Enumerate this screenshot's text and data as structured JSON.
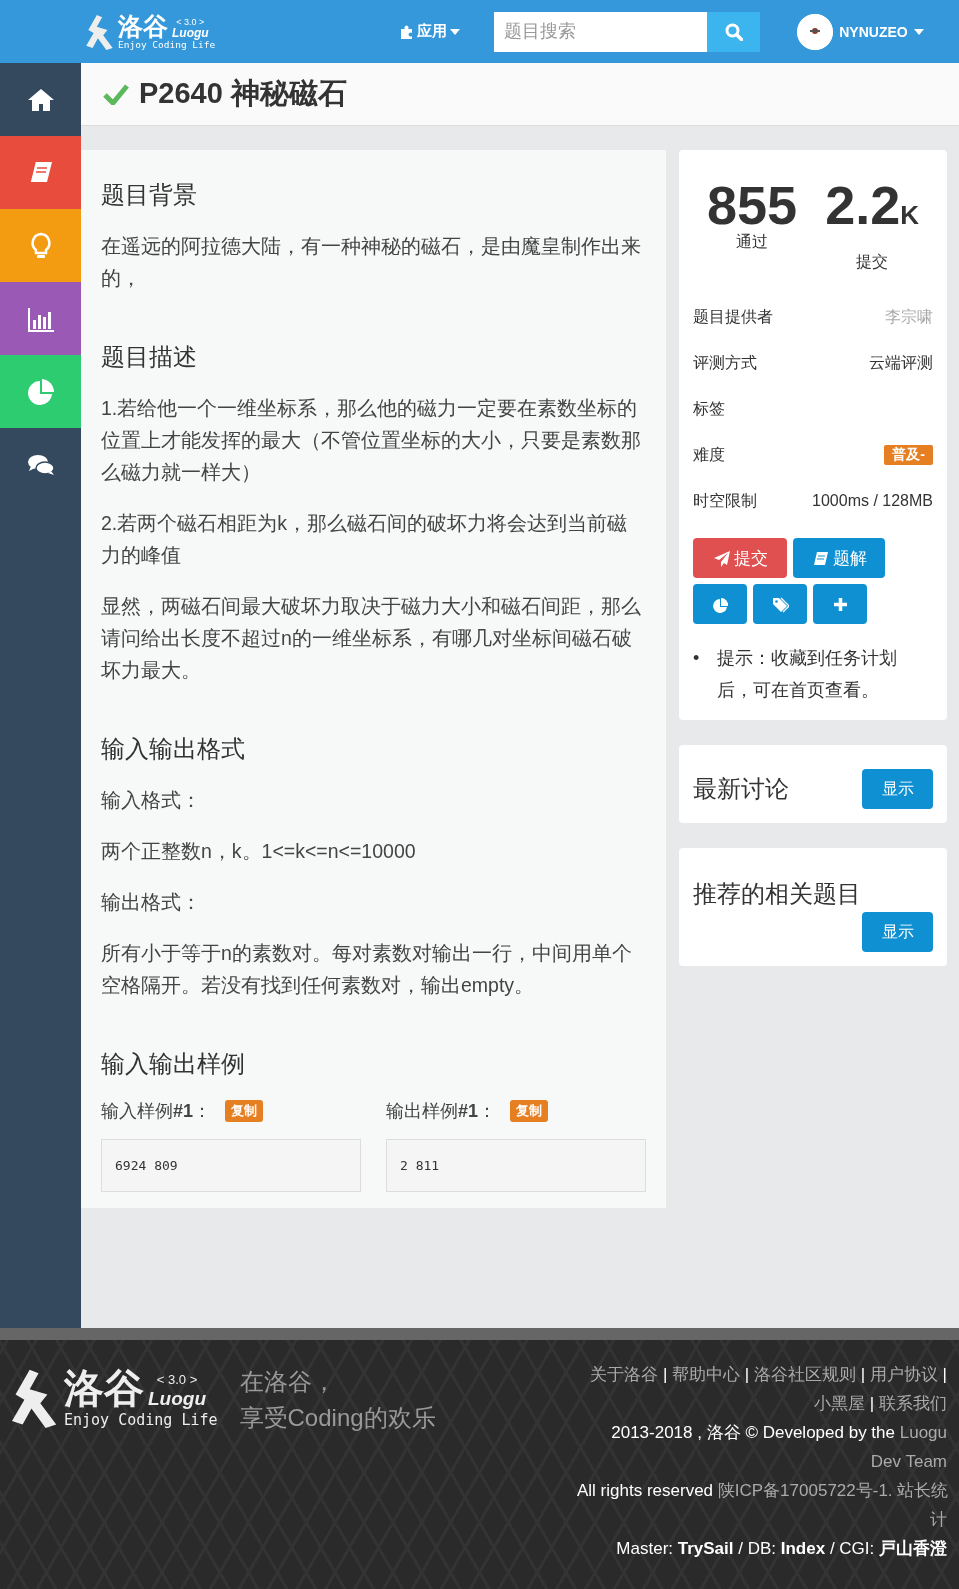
{
  "header": {
    "logo": {
      "name": "洛谷",
      "version": "< 3.0 >",
      "latin": "Luogu",
      "slogan": "Enjoy Coding Life"
    },
    "nav": {
      "label": "应用"
    },
    "search": {
      "placeholder": "题目搜索"
    },
    "user": {
      "name": "NYNUZEO"
    }
  },
  "sidebar": {
    "items": [
      {
        "color": "#34495e",
        "selected": false
      },
      {
        "color": "#e74c3c",
        "selected": false
      },
      {
        "color": "#f39c12",
        "selected": false
      },
      {
        "color": "#9b59b6",
        "selected": false
      },
      {
        "color": "#2ecc71",
        "selected": false
      },
      {
        "color": "#34495e",
        "selected": false
      }
    ]
  },
  "problem": {
    "solved": true,
    "title": "P2640 神秘磁石"
  },
  "content": {
    "sections": [
      {
        "heading": "题目背景",
        "blocks": [
          "在遥远的阿拉德大陆，有一种神秘的磁石，是由魔皇制作出来的，"
        ]
      },
      {
        "heading": "题目描述",
        "blocks": [
          "1.若给他一个一维坐标系，那么他的磁力一定要在素数坐标的位置上才能发挥的最大（不管位置坐标的大小，只要是素数那么磁力就一样大）",
          "2.若两个磁石相距为k，那么磁石间的破坏力将会达到当前磁力的峰值",
          "显然，两磁石间最大破坏力取决于磁力大小和磁石间距，那么请问给出长度不超过n的一维坐标系，有哪几对坐标间磁石破坏力最大。"
        ]
      },
      {
        "heading": "输入输出格式",
        "blocks": [
          "输入格式：",
          "两个正整数n，k。1<=k<=n<=10000",
          "输出格式：",
          "所有小于等于n的素数对。每对素数对输出一行，中间用单个空格隔开。若没有找到任何素数对，输出empty。"
        ]
      },
      {
        "heading": "输入输出样例",
        "samples": [
          {
            "label": "输入样例**#1**：",
            "copy": "复制",
            "value": "6924 809"
          },
          {
            "label": "输出样例**#1**：",
            "copy": "复制",
            "value": "2 811"
          }
        ]
      }
    ]
  },
  "stats": {
    "accepted": {
      "value": "855",
      "label": "通过"
    },
    "submitted": {
      "value": "2.2",
      "unit": "K",
      "label": "提交"
    }
  },
  "info": [
    {
      "label": "题目提供者",
      "kind": "link",
      "value": "李宗啸"
    },
    {
      "label": "评测方式",
      "kind": "text",
      "value": "云端评测"
    },
    {
      "label": "标签",
      "kind": "empty"
    },
    {
      "label": "难度",
      "kind": "badge",
      "value": "普及-"
    },
    {
      "label": "时空限制",
      "kind": "text",
      "value": "1000ms / 128MB"
    }
  ],
  "actions": [
    {
      "kind": "submit",
      "label": "提交"
    },
    {
      "kind": "solution",
      "label": "题解"
    },
    {
      "kind": "stats"
    },
    {
      "kind": "tags"
    },
    {
      "kind": "add"
    }
  ],
  "tips": [
    {
      "marker": "•",
      "text": "提示：收藏到任务计划后，可在首页查看。"
    }
  ],
  "panels": [
    {
      "title": "最新讨论",
      "button": "显示"
    },
    {
      "title": "推荐的相关题目",
      "button": "显示"
    }
  ],
  "footer": {
    "logo": {
      "name": "洛谷",
      "version": "< 3.0 >",
      "latin": "Luogu",
      "slogan": "Enjoy Coding Life"
    },
    "tagline": [
      "在洛谷，",
      "享受Coding的欢乐"
    ],
    "lines": [
      [
        {
          "text": "关于洛谷",
          "link": true
        },
        {
          "text": " | ",
          "link": false
        },
        {
          "text": "帮助中心",
          "link": true
        },
        {
          "text": " | ",
          "link": false
        },
        {
          "text": "洛谷社区规则",
          "link": true
        },
        {
          "text": " | ",
          "link": false
        },
        {
          "text": "用户协议",
          "link": true
        },
        {
          "text": " |",
          "link": false
        }
      ],
      [
        {
          "text": "小黑屋",
          "link": true
        },
        {
          "text": " | ",
          "link": false
        },
        {
          "text": "联系我们",
          "link": true
        }
      ],
      [
        {
          "text": "2013-2018 , 洛谷 © Developed by the ",
          "link": false
        },
        {
          "text": "Luogu",
          "link": true
        }
      ],
      [
        {
          "text": "Dev Team",
          "link": true
        }
      ],
      [
        {
          "text": "All rights reserved ",
          "link": false
        },
        {
          "text": "陕ICP备17005722号-1. 站长统",
          "link": true
        }
      ],
      [
        {
          "text": "计",
          "link": true
        }
      ],
      [
        {
          "text": "Master: **TrySail** / DB: **Index** / CGI: **戸山香澄**",
          "link": false
        }
      ]
    ]
  }
}
